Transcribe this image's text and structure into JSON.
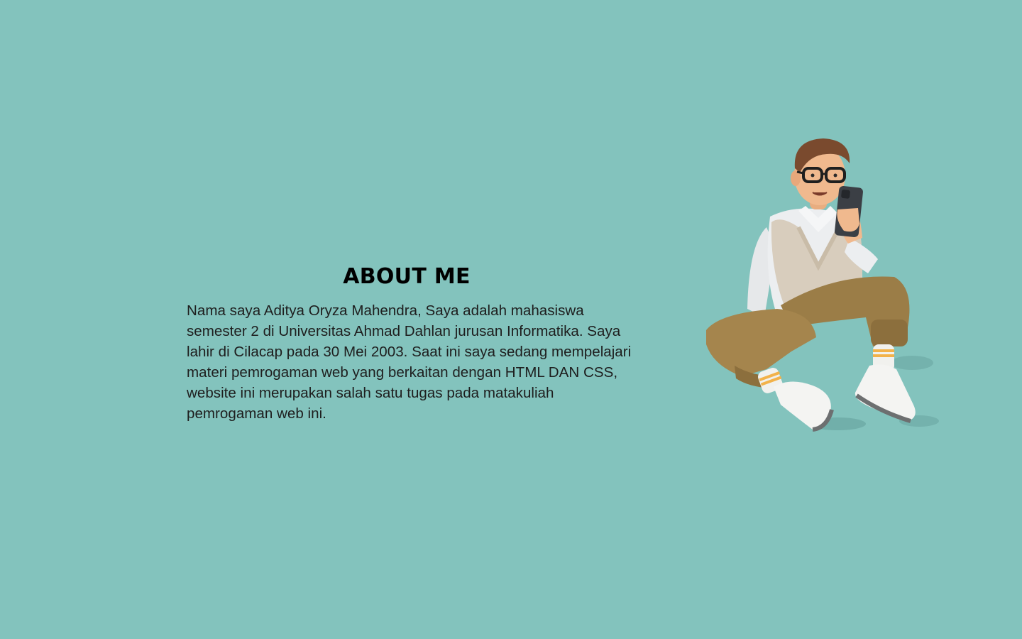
{
  "page": {
    "background_color": "#83c3bd"
  },
  "about": {
    "title": "ABOUT ME",
    "paragraph": "Nama saya Aditya Oryza Mahendra, Saya adalah mahasiswa semester 2 di Universitas Ahmad Dahlan jurusan Informatika. Saya lahir di Cilacap pada 30 Mei 2003. Saat ini saya sedang mempelajari materi pemrogaman web yang berkaitan dengan HTML DAN CSS, website ini merupakan salah satu tugas pada matakuliah pemrogaman web ini."
  },
  "illustration": {
    "icon": "person-sitting-with-phone-illustration",
    "colors": {
      "skin": "#f0b98e",
      "hair": "#7a4a2e",
      "shirt": "#eceef0",
      "vest": "#d8cdbd",
      "pants": "#9b7d47",
      "shoes": "#f4f4f2",
      "socks_stripe": "#f2b24a",
      "phone": "#3b3f45"
    }
  }
}
